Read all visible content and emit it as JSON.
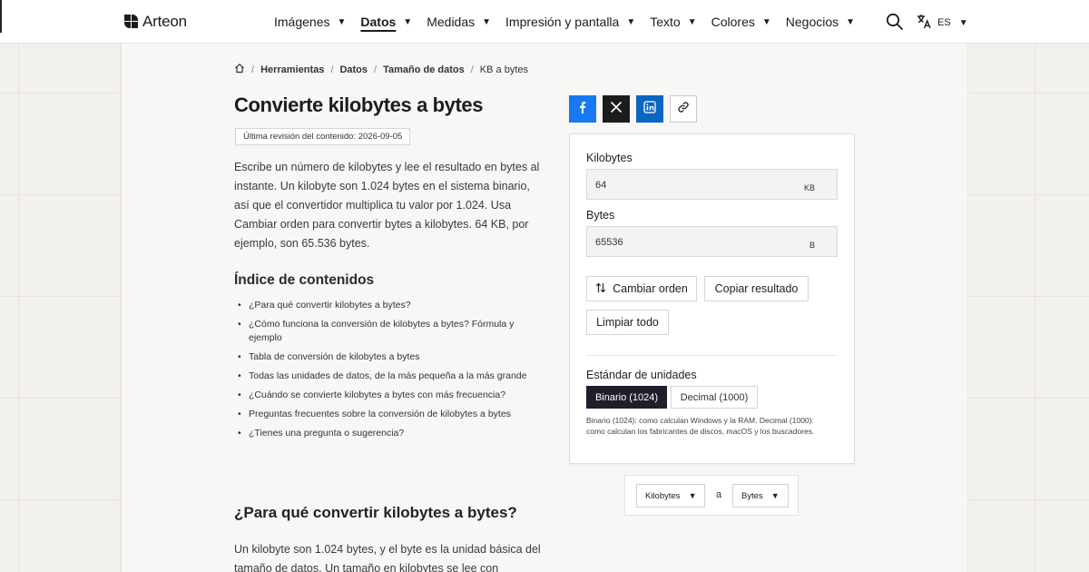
{
  "brand": {
    "name": "Arteon"
  },
  "nav": {
    "items": [
      {
        "label": "Imágenes"
      },
      {
        "label": "Datos"
      },
      {
        "label": "Medidas"
      },
      {
        "label": "Impresión y pantalla"
      },
      {
        "label": "Texto"
      },
      {
        "label": "Colores"
      },
      {
        "label": "Negocios"
      }
    ],
    "active": "Datos",
    "caret": "▼"
  },
  "header": {
    "lang": "ES",
    "lang_caret": "▼"
  },
  "breadcrumb": {
    "items": [
      "Herramientas",
      "Datos",
      "Tamaño de datos"
    ],
    "current": "KB a bytes",
    "separator": "/"
  },
  "page": {
    "title": "Convierte kilobytes a bytes",
    "revision": "Última revisión del contenido: 2026-09-05",
    "intro": "Escribe un número de kilobytes y lee el resultado en bytes al instante. Un kilobyte son 1.024 bytes en el sistema binario, así que el convertidor multiplica tu valor por 1.024. Usa Cambiar orden para convertir bytes a kilobytes. 64 KB, por ejemplo, son 65.536 bytes.",
    "toc_title": "Índice de contenidos",
    "toc": [
      "¿Para qué convertir kilobytes a bytes?",
      "¿Cómo funciona la conversión de kilobytes a bytes? Fórmula y ejemplo",
      "Tabla de conversión de kilobytes a bytes",
      "Todas las unidades de datos, de la más pequeña a la más grande",
      "¿Cuándo se convierte kilobytes a bytes con más frecuencia?",
      "Preguntas frecuentes sobre la conversión de kilobytes a bytes",
      "¿Tienes una pregunta o sugerencia?"
    ],
    "section_title": "¿Para qué convertir kilobytes a bytes?",
    "section_text": "Un kilobyte son 1.024 bytes, y el byte es la unidad básica del tamaño de datos. Un tamaño en kilobytes se lee con"
  },
  "converter": {
    "from_label": "Kilobytes",
    "from_value": "64",
    "from_unit": "KB",
    "to_label": "Bytes",
    "to_value": "65536",
    "to_unit": "B",
    "swap_label": "Cambiar orden",
    "copy_label": "Copiar resultado",
    "clear_label": "Limpiar todo",
    "standard_label": "Estándar de unidades",
    "binary_label": "Binario (1024)",
    "decimal_label": "Decimal (1000)",
    "selected_standard": "Binario (1024)",
    "note": "Binario (1024): como calculan Windows y la RAM. Decimal (1000): como calculan los fabricantes de discos, macOS y los buscadores."
  },
  "unit_selector": {
    "from": "Kilobytes",
    "connector": "a",
    "to": "Bytes",
    "caret": "▼"
  },
  "colors": {
    "accent_dark": "#1e1f2b",
    "facebook": "#1877f2",
    "x": "#1c1c1c",
    "linkedin": "#0a66c2"
  },
  "icons": {
    "logo": "arteon-logo-icon",
    "search": "search-icon",
    "language": "translate-icon",
    "home": "home-icon",
    "facebook": "facebook-icon",
    "x": "x-icon",
    "linkedin": "linkedin-icon",
    "link": "link-icon",
    "swap": "swap-icon"
  }
}
